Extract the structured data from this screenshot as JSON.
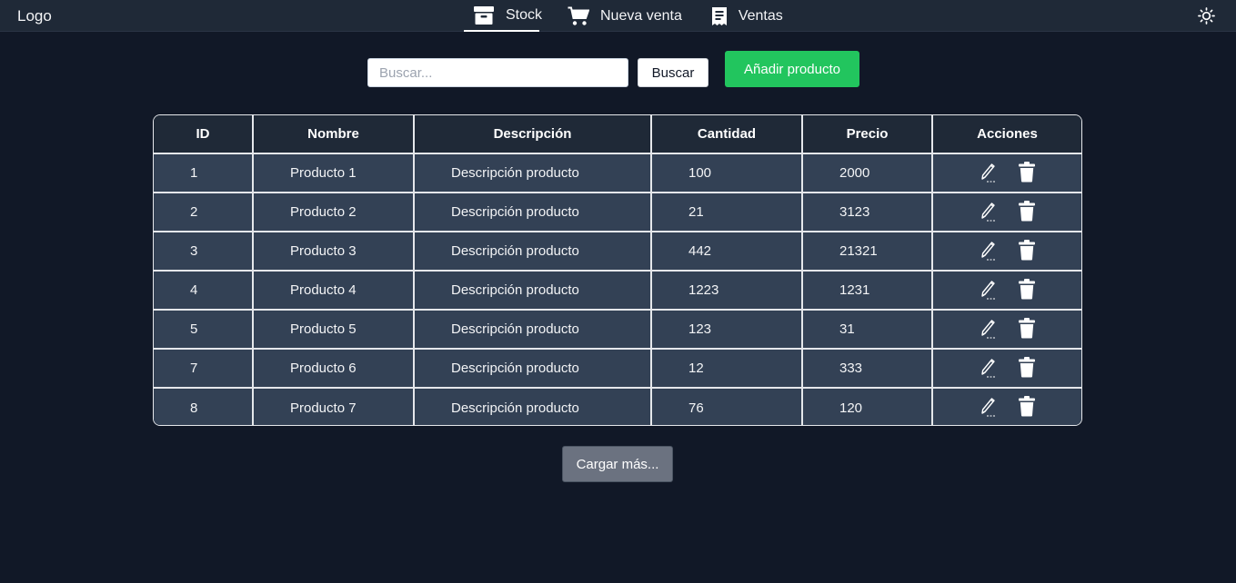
{
  "navbar": {
    "logo": "Logo",
    "links": [
      {
        "label": "Stock",
        "icon": "archive-box-icon",
        "active": true
      },
      {
        "label": "Nueva venta",
        "icon": "shopping-cart-icon",
        "active": false
      },
      {
        "label": "Ventas",
        "icon": "receipt-icon",
        "active": false
      }
    ],
    "theme_icon": "sun-icon"
  },
  "toolbar": {
    "search_placeholder": "Buscar...",
    "search_value": "",
    "search_button": "Buscar",
    "add_button": "Añadir producto"
  },
  "table": {
    "headers": [
      "ID",
      "Nombre",
      "Descripción",
      "Cantidad",
      "Precio",
      "Acciones"
    ],
    "rows": [
      {
        "id": "1",
        "name": "Producto 1",
        "description": "Descripción producto",
        "quantity": "100",
        "price": "2000"
      },
      {
        "id": "2",
        "name": "Producto 2",
        "description": "Descripción producto",
        "quantity": "21",
        "price": "3123"
      },
      {
        "id": "3",
        "name": "Producto 3",
        "description": "Descripción producto",
        "quantity": "442",
        "price": "21321"
      },
      {
        "id": "4",
        "name": "Producto 4",
        "description": "Descripción producto",
        "quantity": "1223",
        "price": "1231"
      },
      {
        "id": "5",
        "name": "Producto 5",
        "description": "Descripción producto",
        "quantity": "123",
        "price": "31"
      },
      {
        "id": "7",
        "name": "Producto 6",
        "description": "Descripción producto",
        "quantity": "12",
        "price": "333"
      },
      {
        "id": "8",
        "name": "Producto 7",
        "description": "Descripción producto",
        "quantity": "76",
        "price": "120"
      }
    ],
    "row_action_icons": [
      "pencil-icon",
      "trash-icon"
    ]
  },
  "load_more_button": "Cargar más...",
  "colors": {
    "background": "#111827",
    "navbar": "#1f2937",
    "row": "#334155",
    "accent_green": "#22c55e",
    "load_more": "#6b7280"
  }
}
